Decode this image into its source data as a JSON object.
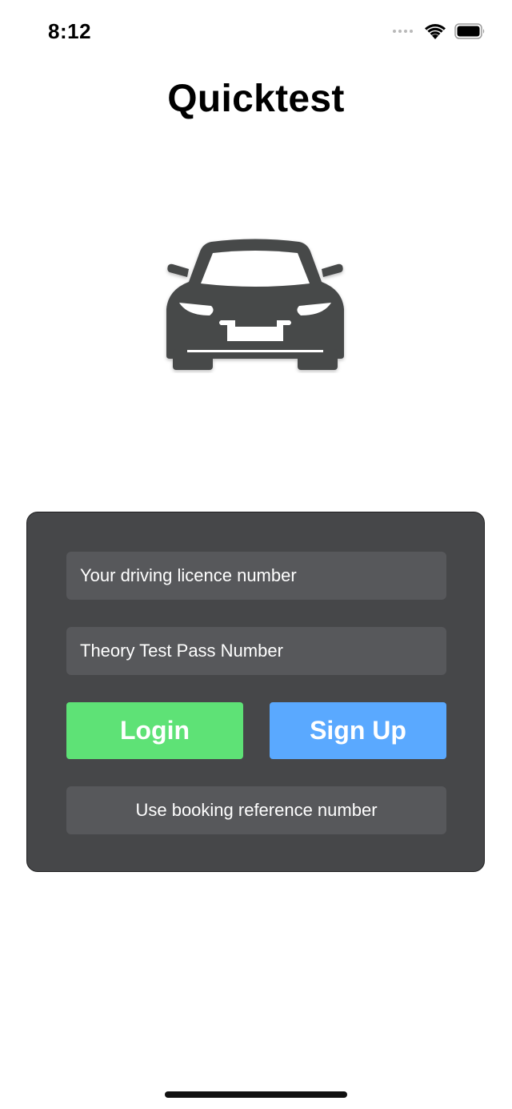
{
  "status_bar": {
    "time": "8:12"
  },
  "app": {
    "title": "Quicktest",
    "logo_icon": "car-front-icon"
  },
  "form": {
    "licence_placeholder": "Your driving licence number",
    "theory_placeholder": "Theory Test Pass Number",
    "login_label": "Login",
    "signup_label": "Sign Up",
    "booking_label": "Use booking reference number"
  },
  "colors": {
    "card_bg": "#464749",
    "field_bg": "#57585b",
    "login_green": "#5ee276",
    "signup_blue": "#5aa9ff",
    "car_gray": "#47484a"
  }
}
